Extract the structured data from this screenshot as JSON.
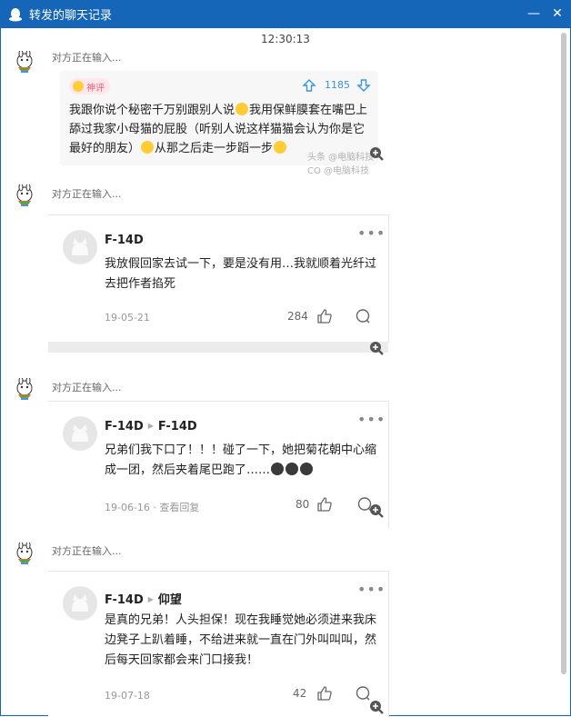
{
  "window": {
    "title": "转发的聊天记录",
    "minimize_label": "—",
    "close_label": "✕"
  },
  "timestamp": "12:30:13",
  "typing_label": "对方正在输入...",
  "first_card": {
    "badge": "神评",
    "up_count": "1185",
    "text_1": "我跟你说个秘密千万别跟别人说",
    "text_2": "我用保鲜膜套在嘴巴上舔过我家小母猫的屁股（听别人说这样猫猫会认为你是它最好的朋友）",
    "text_3": "从那之后走一步蹈一步",
    "watermark": "头条 @电脑科技CO @电脑科技"
  },
  "comments": [
    {
      "name": "F-14D",
      "reply_to": "",
      "text": "我放假回家去试一下，要是没有用…我就顺着光纤过去把作者掐死",
      "text_tail": "",
      "date": "19-05-21",
      "meta": "",
      "likes": "284"
    },
    {
      "name": "F-14D",
      "reply_to": "F-14D",
      "text": "兄弟们我下口了！！！碰了一下，她把菊花朝中心缩成一团，然后夹着尾巴跑了……",
      "text_tail": "",
      "date": "19-06-16",
      "meta": " · 查看回复",
      "likes": "80"
    },
    {
      "name": "F-14D",
      "reply_to": "仰望",
      "text": "是真的兄弟！人头担保！现在我睡觉她必须进来我床边凳子上趴着睡，不给进来就一直在门外叫叫叫，然后每天回家都会来门口接我！",
      "text_tail": "",
      "date": "19-07-18",
      "meta": "",
      "likes": "42"
    }
  ],
  "more_label": "•••",
  "colors": {
    "titlebar": "#1565b8",
    "accent": "#3a93d8",
    "badge": "#f25c7a"
  }
}
